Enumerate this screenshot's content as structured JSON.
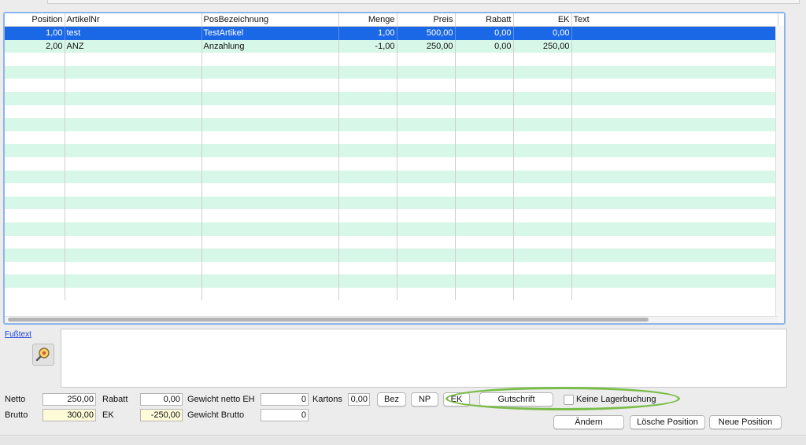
{
  "table": {
    "columns": [
      {
        "key": "position",
        "label": "Position",
        "align": "r",
        "width": 76
      },
      {
        "key": "artikelnr",
        "label": "ArtikelNr",
        "align": "l",
        "width": 174
      },
      {
        "key": "posbez",
        "label": "PosBezeichnung",
        "align": "l",
        "width": 174
      },
      {
        "key": "menge",
        "label": "Menge",
        "align": "r",
        "width": 74
      },
      {
        "key": "preis",
        "label": "Preis",
        "align": "r",
        "width": 74
      },
      {
        "key": "rabatt",
        "label": "Rabatt",
        "align": "r",
        "width": 74
      },
      {
        "key": "ek",
        "label": "EK",
        "align": "r",
        "width": 74
      },
      {
        "key": "text",
        "label": "Text",
        "align": "l",
        "width": 262
      }
    ],
    "rows": [
      {
        "position": "1,00",
        "artikelnr": "test",
        "posbez": "TestArtikel",
        "menge": "1,00",
        "preis": "500,00",
        "rabatt": "0,00",
        "ek": "0,00",
        "text": "",
        "selected": true
      },
      {
        "position": "2,00",
        "artikelnr": "ANZ",
        "posbez": "Anzahlung",
        "menge": "-1,00",
        "preis": "250,00",
        "rabatt": "0,00",
        "ek": "250,00",
        "text": "",
        "selected": false
      }
    ],
    "empty_rows": 19
  },
  "footer_text": {
    "link": "Fußtext",
    "icon": "magnifier-icon"
  },
  "totals": {
    "netto_label": "Netto",
    "netto": "250,00",
    "brutto_label": "Brutto",
    "brutto": "300,00",
    "rabatt_label": "Rabatt",
    "rabatt": "0,00",
    "ek_label": "EK",
    "ek": "-250,00",
    "gew_netto_label": "Gewicht netto EH",
    "gew_netto": "0",
    "gew_brutto_label": "Gewicht Brutto",
    "gew_brutto": "0",
    "kartons_label": "Kartons",
    "kartons": "0,00"
  },
  "buttons": {
    "bez": "Bez",
    "np": "NP",
    "ek": "EK",
    "gutschrift": "Gutschrift",
    "aendern": "Ändern",
    "loesche": "Lösche Position",
    "neue": "Neue Position"
  },
  "checkbox": {
    "label": "Keine Lagerbuchung",
    "checked": false
  },
  "colors": {
    "selection": "#1b68e6",
    "row_alt": "#d7f7e8",
    "highlight": "#7bbd4a"
  }
}
